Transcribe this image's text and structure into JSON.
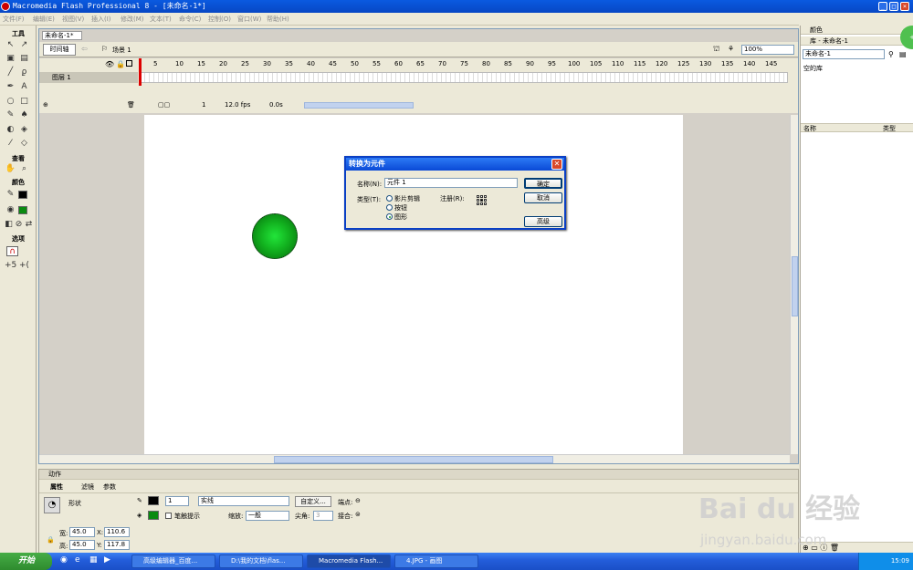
{
  "window": {
    "title": "Macromedia Flash Professional 8 - [未命名-1*]"
  },
  "menu": [
    "文件(F)",
    "编辑(E)",
    "视图(V)",
    "插入(I)",
    "修改(M)",
    "文本(T)",
    "命令(C)",
    "控制(O)",
    "窗口(W)",
    "帮助(H)"
  ],
  "toolbox": {
    "tools_label": "工具",
    "view_label": "查看",
    "colors_label": "颜色",
    "options_label": "选项"
  },
  "document": {
    "tab": "未命名-1*",
    "timeline_button": "时间轴",
    "scene": "场景 1",
    "zoom": "100%",
    "layer_name": "图层 1",
    "ruler": [
      "5",
      "10",
      "15",
      "20",
      "25",
      "30",
      "35",
      "40",
      "45",
      "50",
      "55",
      "60",
      "65",
      "70",
      "75",
      "80",
      "85",
      "90",
      "95",
      "100",
      "105",
      "110",
      "115",
      "120",
      "125",
      "130",
      "135",
      "140",
      "145"
    ],
    "frame": "1",
    "fps": "12.0 fps",
    "time": "0.0s"
  },
  "dialog": {
    "title": "转换为元件",
    "name_label": "名称(N):",
    "name_value": "元件 1",
    "type_label": "类型(T):",
    "types": [
      "影片剪辑",
      "按钮",
      "图形"
    ],
    "selected_type": "图形",
    "registration_label": "注册(R):",
    "ok": "确定",
    "cancel": "取消",
    "advanced": "高级"
  },
  "right_panel": {
    "color_header": "颜色",
    "library_header": "库 - 未命名-1",
    "library_select": "未命名-1",
    "empty_label": "空的库",
    "col_name": "名称",
    "col_type": "类型"
  },
  "properties": {
    "actions_header": "动作",
    "tabs": [
      "属性",
      "滤镜",
      "参数"
    ],
    "shape_label": "形状",
    "stroke_size": "1",
    "stroke_style": "实线",
    "custom_button": "自定义...",
    "endpoint_label": "端点:",
    "hinting_label": "笔触提示",
    "scale_label": "缩放:",
    "scale_value": "一般",
    "miter_label": "尖角:",
    "miter_value": "3",
    "join_label": "接合:",
    "width_label": "宽:",
    "width_value": "45.0",
    "height_label": "高:",
    "height_value": "45.0",
    "x_label": "X:",
    "x_value": "110.6",
    "y_label": "Y:",
    "y_value": "117.8"
  },
  "taskbar": {
    "start": "开始",
    "tasks": [
      "高级编辑器_百度...",
      "D:\\我的文档\\flas...",
      "Macromedia Flash...",
      "4.JPG - 画图"
    ],
    "clock": "15:09"
  },
  "watermark": {
    "main": "Bai du 经验",
    "sub": "jingyan.baidu.com"
  },
  "colors": {
    "title_blue": "#0a5ae0",
    "stage": "#ffffff",
    "circle": "#12b21f",
    "accent": "#0a3fc4"
  }
}
